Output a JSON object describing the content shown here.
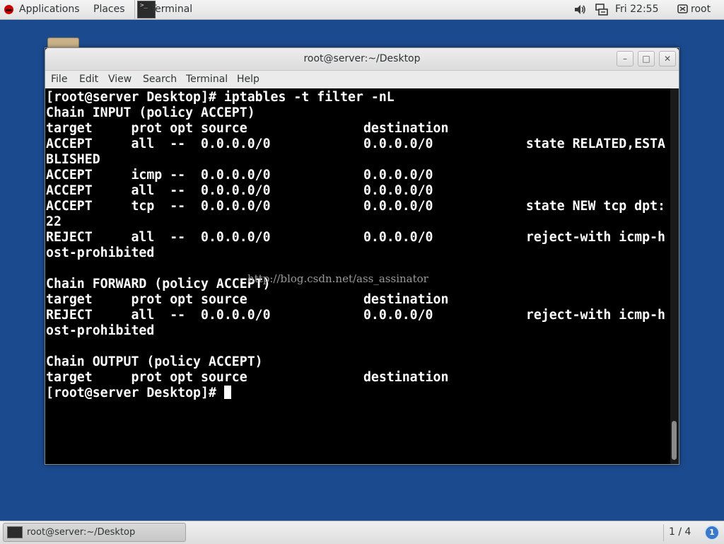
{
  "topbar": {
    "applications_label": "Applications",
    "places_label": "Places",
    "terminal_app_label": "Terminal",
    "terminal_icon_glyph": ">_",
    "clock": "Fri 22:55",
    "user_label": "root",
    "icons": [
      "redhat-icon",
      "terminal-icon",
      "speaker-icon",
      "network-icon",
      "user-icon"
    ]
  },
  "window": {
    "title": "root@server:~/Desktop",
    "minimize_glyph": "–",
    "maximize_glyph": "□",
    "close_glyph": "✕",
    "menu": [
      "File",
      "Edit",
      "View",
      "Search",
      "Terminal",
      "Help"
    ]
  },
  "terminal": {
    "lines": [
      "[root@server Desktop]# iptables -t filter -nL",
      "Chain INPUT (policy ACCEPT)",
      "target     prot opt source               destination",
      "ACCEPT     all  --  0.0.0.0/0            0.0.0.0/0            state RELATED,ESTA",
      "BLISHED",
      "ACCEPT     icmp --  0.0.0.0/0            0.0.0.0/0",
      "ACCEPT     all  --  0.0.0.0/0            0.0.0.0/0",
      "ACCEPT     tcp  --  0.0.0.0/0            0.0.0.0/0            state NEW tcp dpt:",
      "22",
      "REJECT     all  --  0.0.0.0/0            0.0.0.0/0            reject-with icmp-h",
      "ost-prohibited",
      "",
      "Chain FORWARD (policy ACCEPT)",
      "target     prot opt source               destination",
      "REJECT     all  --  0.0.0.0/0            0.0.0.0/0            reject-with icmp-h",
      "ost-prohibited",
      "",
      "Chain OUTPUT (policy ACCEPT)",
      "target     prot opt source               destination"
    ],
    "prompt": "[root@server Desktop]# ",
    "watermark": "http://blog.csdn.net/ass_assinator",
    "colors": {
      "background": "#000000",
      "foreground": "#ffffff"
    }
  },
  "taskbar": {
    "task_label": "root@server:~/Desktop",
    "workspace": "1 / 4",
    "notification_count": "1"
  },
  "colors": {
    "desktop_background": "#1b4a8e",
    "accent": "#3a78c9"
  }
}
